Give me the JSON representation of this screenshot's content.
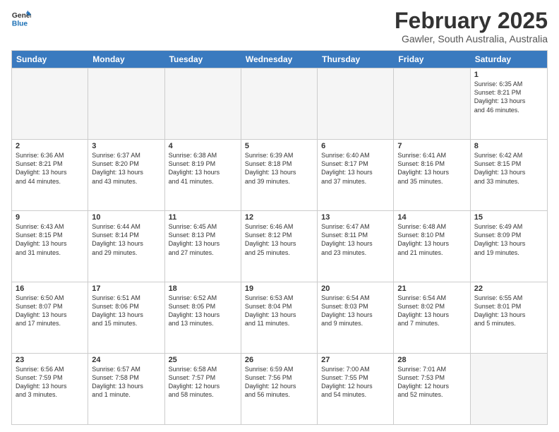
{
  "header": {
    "logo_line1": "General",
    "logo_line2": "Blue",
    "month_title": "February 2025",
    "location": "Gawler, South Australia, Australia"
  },
  "days": [
    "Sunday",
    "Monday",
    "Tuesday",
    "Wednesday",
    "Thursday",
    "Friday",
    "Saturday"
  ],
  "rows": [
    [
      {
        "num": "",
        "info": ""
      },
      {
        "num": "",
        "info": ""
      },
      {
        "num": "",
        "info": ""
      },
      {
        "num": "",
        "info": ""
      },
      {
        "num": "",
        "info": ""
      },
      {
        "num": "",
        "info": ""
      },
      {
        "num": "1",
        "info": "Sunrise: 6:35 AM\nSunset: 8:21 PM\nDaylight: 13 hours\nand 46 minutes."
      }
    ],
    [
      {
        "num": "2",
        "info": "Sunrise: 6:36 AM\nSunset: 8:21 PM\nDaylight: 13 hours\nand 44 minutes."
      },
      {
        "num": "3",
        "info": "Sunrise: 6:37 AM\nSunset: 8:20 PM\nDaylight: 13 hours\nand 43 minutes."
      },
      {
        "num": "4",
        "info": "Sunrise: 6:38 AM\nSunset: 8:19 PM\nDaylight: 13 hours\nand 41 minutes."
      },
      {
        "num": "5",
        "info": "Sunrise: 6:39 AM\nSunset: 8:18 PM\nDaylight: 13 hours\nand 39 minutes."
      },
      {
        "num": "6",
        "info": "Sunrise: 6:40 AM\nSunset: 8:17 PM\nDaylight: 13 hours\nand 37 minutes."
      },
      {
        "num": "7",
        "info": "Sunrise: 6:41 AM\nSunset: 8:16 PM\nDaylight: 13 hours\nand 35 minutes."
      },
      {
        "num": "8",
        "info": "Sunrise: 6:42 AM\nSunset: 8:15 PM\nDaylight: 13 hours\nand 33 minutes."
      }
    ],
    [
      {
        "num": "9",
        "info": "Sunrise: 6:43 AM\nSunset: 8:15 PM\nDaylight: 13 hours\nand 31 minutes."
      },
      {
        "num": "10",
        "info": "Sunrise: 6:44 AM\nSunset: 8:14 PM\nDaylight: 13 hours\nand 29 minutes."
      },
      {
        "num": "11",
        "info": "Sunrise: 6:45 AM\nSunset: 8:13 PM\nDaylight: 13 hours\nand 27 minutes."
      },
      {
        "num": "12",
        "info": "Sunrise: 6:46 AM\nSunset: 8:12 PM\nDaylight: 13 hours\nand 25 minutes."
      },
      {
        "num": "13",
        "info": "Sunrise: 6:47 AM\nSunset: 8:11 PM\nDaylight: 13 hours\nand 23 minutes."
      },
      {
        "num": "14",
        "info": "Sunrise: 6:48 AM\nSunset: 8:10 PM\nDaylight: 13 hours\nand 21 minutes."
      },
      {
        "num": "15",
        "info": "Sunrise: 6:49 AM\nSunset: 8:09 PM\nDaylight: 13 hours\nand 19 minutes."
      }
    ],
    [
      {
        "num": "16",
        "info": "Sunrise: 6:50 AM\nSunset: 8:07 PM\nDaylight: 13 hours\nand 17 minutes."
      },
      {
        "num": "17",
        "info": "Sunrise: 6:51 AM\nSunset: 8:06 PM\nDaylight: 13 hours\nand 15 minutes."
      },
      {
        "num": "18",
        "info": "Sunrise: 6:52 AM\nSunset: 8:05 PM\nDaylight: 13 hours\nand 13 minutes."
      },
      {
        "num": "19",
        "info": "Sunrise: 6:53 AM\nSunset: 8:04 PM\nDaylight: 13 hours\nand 11 minutes."
      },
      {
        "num": "20",
        "info": "Sunrise: 6:54 AM\nSunset: 8:03 PM\nDaylight: 13 hours\nand 9 minutes."
      },
      {
        "num": "21",
        "info": "Sunrise: 6:54 AM\nSunset: 8:02 PM\nDaylight: 13 hours\nand 7 minutes."
      },
      {
        "num": "22",
        "info": "Sunrise: 6:55 AM\nSunset: 8:01 PM\nDaylight: 13 hours\nand 5 minutes."
      }
    ],
    [
      {
        "num": "23",
        "info": "Sunrise: 6:56 AM\nSunset: 7:59 PM\nDaylight: 13 hours\nand 3 minutes."
      },
      {
        "num": "24",
        "info": "Sunrise: 6:57 AM\nSunset: 7:58 PM\nDaylight: 13 hours\nand 1 minute."
      },
      {
        "num": "25",
        "info": "Sunrise: 6:58 AM\nSunset: 7:57 PM\nDaylight: 12 hours\nand 58 minutes."
      },
      {
        "num": "26",
        "info": "Sunrise: 6:59 AM\nSunset: 7:56 PM\nDaylight: 12 hours\nand 56 minutes."
      },
      {
        "num": "27",
        "info": "Sunrise: 7:00 AM\nSunset: 7:55 PM\nDaylight: 12 hours\nand 54 minutes."
      },
      {
        "num": "28",
        "info": "Sunrise: 7:01 AM\nSunset: 7:53 PM\nDaylight: 12 hours\nand 52 minutes."
      },
      {
        "num": "",
        "info": ""
      }
    ]
  ]
}
